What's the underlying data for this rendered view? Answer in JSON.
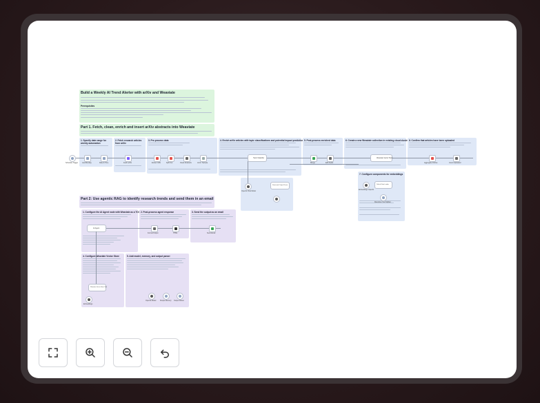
{
  "workflow": {
    "intro_title": "Build a Weekly AI Trend Alerter with arXiv and Weaviate",
    "intro_subheading": "Prerequisites",
    "part1_title": "Part 1. Fetch, clean, enrich and insert arXiv abstracts into Weaviate",
    "part2_title": "Part 2: Use agentic RAG to identify research trends and send them in an email",
    "step1": "1. Specify date range for weekly automation",
    "step2": "2. Fetch research articles from arXiv",
    "step3": "3. Pre-process data",
    "step4": "4. Enrich arXiv articles with topic classifications and potential impact predictions",
    "step5": "5. Post-process enriched data",
    "step6": "6. Create a new Weaviate collection in existing cloud cluster",
    "step7": "7. Configure components for embeddings",
    "step8": "8. Confirm that articles have been uploaded",
    "p2_step1": "1. Configure the AI Agent node with Weaviate as a TOOL",
    "p2_step2": "2. Post-process agent response",
    "p2_step3": "3. Send the output as an email",
    "p2_step4": "4. Configure Weaviate Vector Store",
    "p2_step5": "5. Add model, memory, and output parser",
    "n_trigger": "Schedule Trigger",
    "n_monday": "Last Monday",
    "n_dates": "Date & Time",
    "n_arxiv": "Fetch arXiv",
    "n_extract": "Extract XML",
    "n_split": "Split Out",
    "n_clean": "Clean Abstracts",
    "n_limit": "Limit / Sample",
    "n_classifier": "Topic Classifier",
    "n_merge": "Merge",
    "n_edit": "Edit Fields",
    "n_weaviate": "Weaviate Vector Store",
    "n_aggregate": "Aggregate Articles",
    "n_count": "Count Uploaded",
    "n_openai": "OpenAI Chat Model",
    "n_parser": "Structured Output Parser",
    "n_embeddings": "Embeddings OpenAI",
    "n_loader": "Default Data Loader",
    "n_splitter": "Recursive Text Splitter",
    "n_agent": "AI Agent",
    "n_format": "Format Output",
    "n_html": "HTML",
    "n_gmail": "Send Email",
    "n_vstore": "Weaviate Vector Store Tool",
    "n_embed2": "Embeddings",
    "n_model2": "OpenAI Model",
    "n_memory": "Simple Memory",
    "n_parser2": "Output Parser"
  },
  "controls": {
    "fit_icon": "fit-view-icon",
    "zoom_in_icon": "zoom-in-icon",
    "zoom_out_icon": "zoom-out-icon",
    "undo_icon": "undo-icon"
  },
  "colors": {
    "green_note": "#dcf5de",
    "blue_note": "#dfe8f7",
    "purple_note": "#e6e0f4",
    "accent_purple": "#7c5cff",
    "accent_green": "#3aa657",
    "accent_red": "#e3504a"
  }
}
